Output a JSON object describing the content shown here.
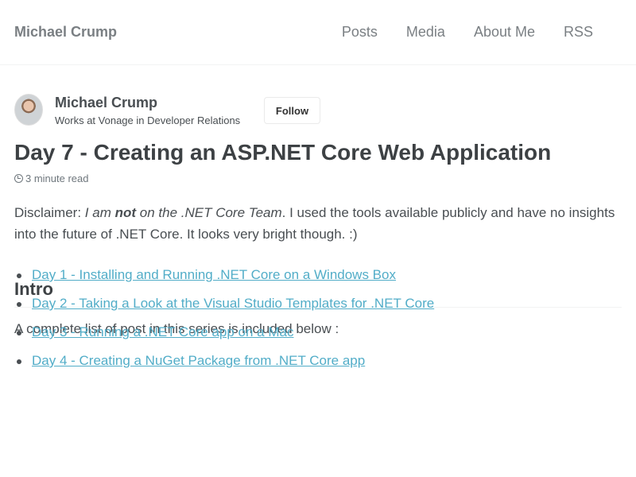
{
  "header": {
    "site_title": "Michael Crump",
    "nav": [
      "Posts",
      "Media",
      "About Me",
      "RSS"
    ]
  },
  "author": {
    "name": "Michael Crump",
    "bio": "Works at Vonage in Developer Relations",
    "follow_label": "Follow"
  },
  "post": {
    "title": "Day 7 - Creating an ASP.NET Core Web Application",
    "read_time": "3 minute read",
    "disclaimer": {
      "lead": "Disclaimer: ",
      "italic_1": "I am ",
      "bold": "not",
      "italic_2": " on the .NET Core Team",
      "rest": ". I used the tools available publicly and have no insights into the future of .NET Core. It looks very bright though. :)"
    },
    "intro_heading": "Intro",
    "intro_text": "A complete list of post in this series is included below :",
    "series_links": [
      "Day 1 - Installing and Running .NET Core on a Windows Box",
      "Day 2 - Taking a Look at the Visual Studio Templates for .NET Core",
      "Day 3 - Running a .NET Core app on a Mac",
      "Day 4 - Creating a NuGet Package from .NET Core app"
    ]
  },
  "colors": {
    "link": "#52adc8",
    "text": "#494e52",
    "nav": "#7a7f83"
  },
  "icons": {
    "read_time": "clock-icon"
  }
}
